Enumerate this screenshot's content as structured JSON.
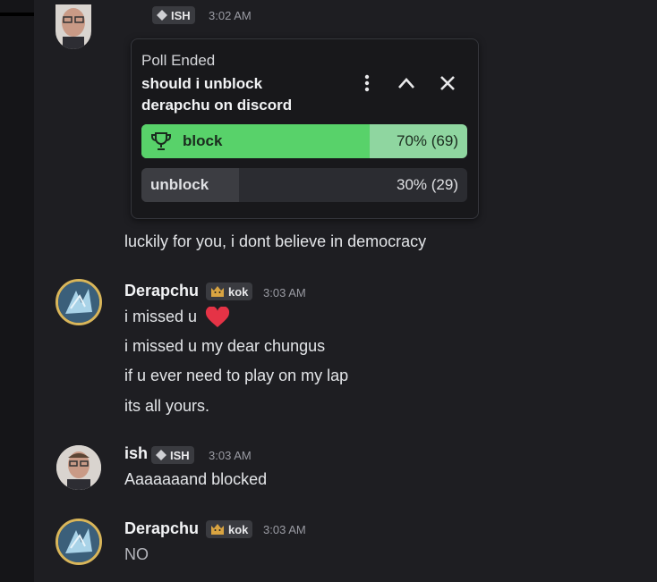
{
  "messages": {
    "m1": {
      "username": "",
      "tag": "ISH",
      "time": "3:02 AM"
    },
    "poll": {
      "status": "Poll Ended",
      "question": "should i unblock derapchu on discord",
      "options": [
        {
          "label": "block",
          "result": "70% (69)",
          "percent": 70,
          "winner": true
        },
        {
          "label": "unblock",
          "result": "30% (29)",
          "percent": 30,
          "winner": false
        }
      ]
    },
    "m1_followup": "luckily for you, i dont believe in democracy",
    "m2": {
      "username": "Derapchu",
      "tag": "kok",
      "time": "3:03 AM",
      "lines": [
        "i missed u",
        "i missed u my dear chungus",
        "if u ever need to play on my lap",
        "its all yours."
      ]
    },
    "m3": {
      "username": "ish",
      "tag": "ISH",
      "time": "3:03 AM",
      "lines": [
        "Aaaaaaand blocked"
      ]
    },
    "m4": {
      "username": "Derapchu",
      "tag": "kok",
      "time": "3:03 AM",
      "lines": [
        "NO"
      ]
    }
  },
  "colors": {
    "winner_fill": "#58d26a",
    "heart": "#e53346"
  },
  "icons": [
    "trophy-icon",
    "more-icon",
    "chevron-up-icon",
    "close-icon",
    "heart-icon",
    "diamond-badge-icon",
    "cat-badge-icon"
  ]
}
